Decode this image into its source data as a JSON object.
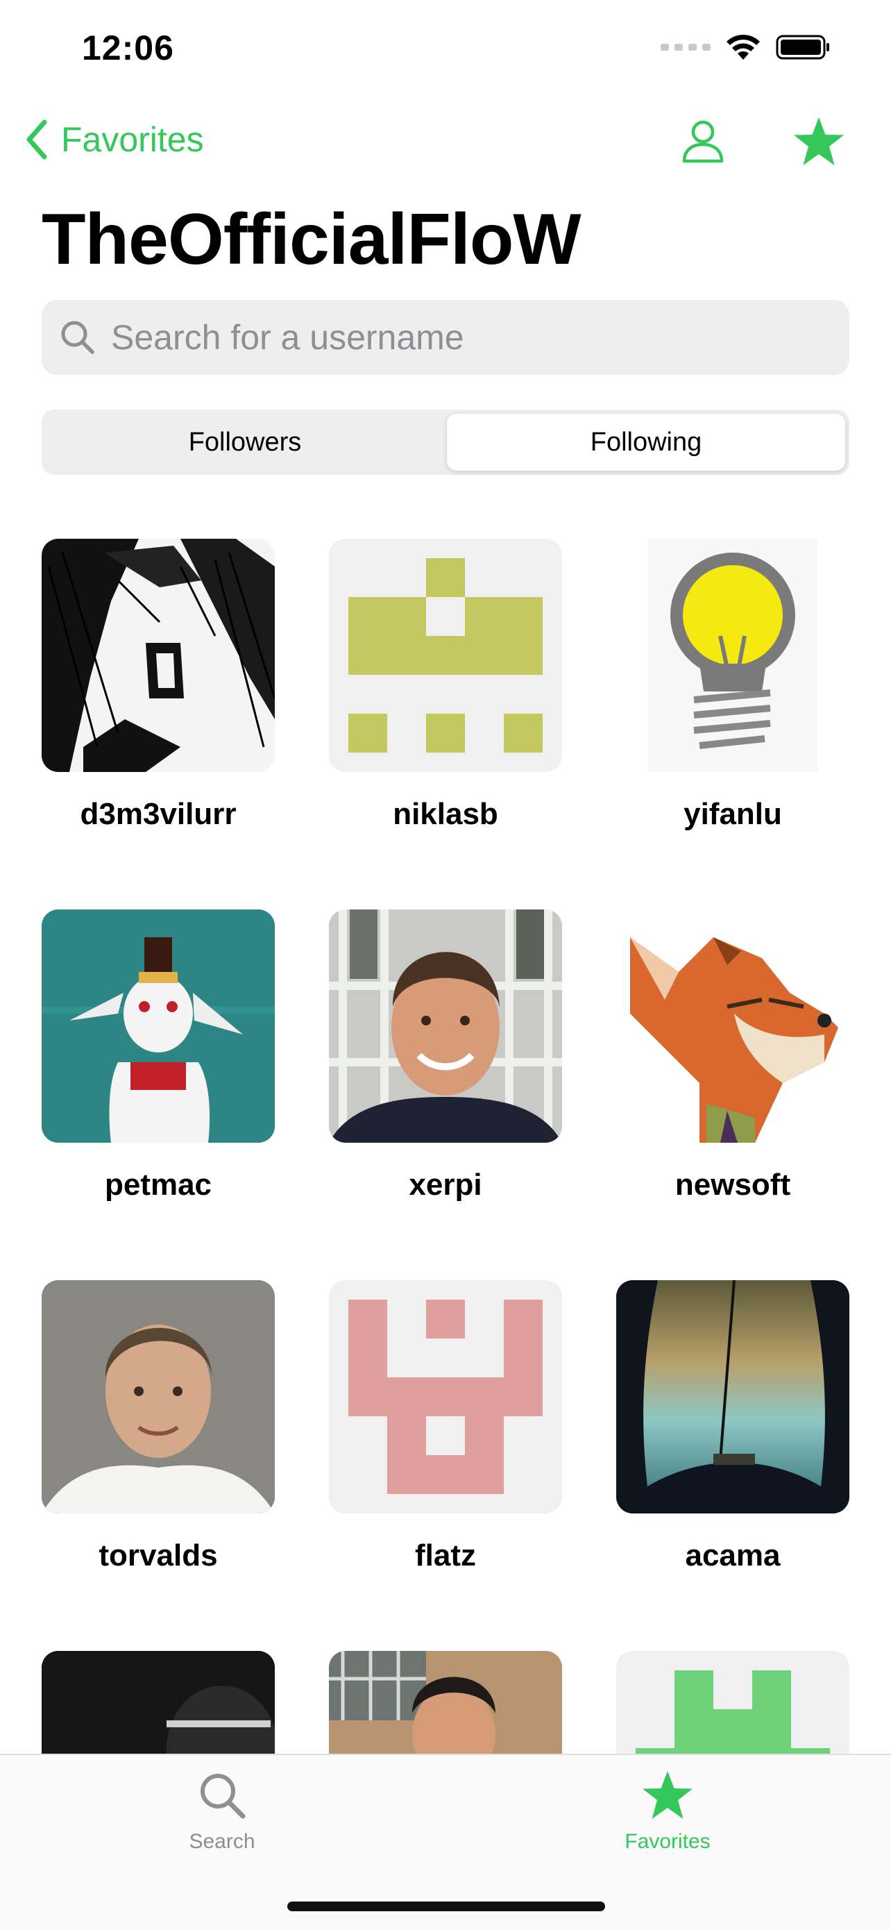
{
  "status": {
    "time": "12:06"
  },
  "nav": {
    "back_label": "Favorites",
    "person_icon": "person-icon",
    "star_icon": "star-icon"
  },
  "title": "TheOfficialFloW",
  "search": {
    "placeholder": "Search for a username",
    "value": ""
  },
  "segments": {
    "items": [
      "Followers",
      "Following"
    ],
    "selected": "Following"
  },
  "users": [
    {
      "name": "d3m3vilurr"
    },
    {
      "name": "niklasb"
    },
    {
      "name": "yifanlu"
    },
    {
      "name": "petmac"
    },
    {
      "name": "xerpi"
    },
    {
      "name": "newsoft"
    },
    {
      "name": "torvalds"
    },
    {
      "name": "flatz"
    },
    {
      "name": "acama"
    },
    {
      "name": ""
    },
    {
      "name": ""
    },
    {
      "name": ""
    }
  ],
  "tabbar": {
    "search_label": "Search",
    "favorites_label": "Favorites",
    "active": "Favorites"
  },
  "colors": {
    "accent": "#34c759",
    "inactive": "#8e8e93",
    "identicon_olive": "#c4c860",
    "identicon_pink": "#dfa09d",
    "identicon_green": "#6dd27a"
  }
}
